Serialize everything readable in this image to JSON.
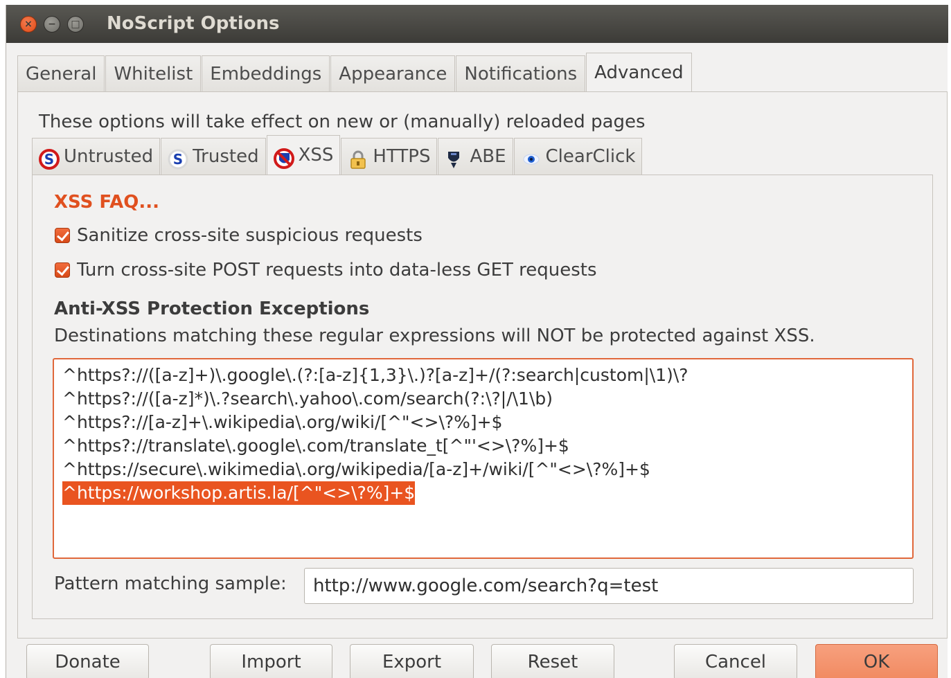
{
  "window": {
    "title": "NoScript Options"
  },
  "main_tabs": [
    {
      "label": "General"
    },
    {
      "label": "Whitelist"
    },
    {
      "label": "Embeddings"
    },
    {
      "label": "Appearance"
    },
    {
      "label": "Notifications"
    },
    {
      "label": "Advanced",
      "active": true
    }
  ],
  "advanced": {
    "info": "These options will take effect on new or (manually) reloaded pages",
    "sub_tabs": [
      {
        "label": "Untrusted",
        "icon": "noscript-red-icon"
      },
      {
        "label": "Trusted",
        "icon": "noscript-blue-icon"
      },
      {
        "label": "XSS",
        "icon": "xss-shield-icon",
        "active": true
      },
      {
        "label": "HTTPS",
        "icon": "lock-icon"
      },
      {
        "label": "ABE",
        "icon": "abe-icon"
      },
      {
        "label": "ClearClick",
        "icon": "clearclick-eye-icon"
      }
    ]
  },
  "xss": {
    "faq_link": "XSS FAQ...",
    "checkboxes": [
      {
        "label": "Sanitize cross-site suspicious requests",
        "checked": true
      },
      {
        "label": "Turn cross-site POST requests into data-less GET requests",
        "checked": true
      }
    ],
    "exceptions_title": "Anti-XSS Protection Exceptions",
    "exceptions_desc": "Destinations matching these regular expressions will NOT be protected against XSS.",
    "exceptions": [
      "^https?://([a-z]+)\\.google\\.(?:[a-z]{1,3}\\.)?[a-z]+/(?:search|custom|\\1)\\?",
      "^https?://([a-z]*)\\.?search\\.yahoo\\.com/search(?:\\?|/\\1\\b)",
      "^https?://[a-z]+\\.wikipedia\\.org/wiki/[^\"<>\\?%]+$",
      "^https?://translate\\.google\\.com/translate_t[^\"'<>\\?%]+$",
      "^https://secure\\.wikimedia\\.org/wikipedia/[a-z]+/wiki/[^\"<>\\?%]+$",
      "^https://workshop.artis.la/[^\"<>\\?%]+$"
    ],
    "selected_exception_index": 5,
    "sample_label": "Pattern matching sample:",
    "sample_value": "http://www.google.com/search?q=test"
  },
  "buttons": {
    "donate": "Donate",
    "import": "Import",
    "export": "Export",
    "reset": "Reset",
    "cancel": "Cancel",
    "ok": "OK"
  },
  "colors": {
    "accent": "#e95420",
    "titlebar": "#3c3b37",
    "link": "#e0501f"
  }
}
